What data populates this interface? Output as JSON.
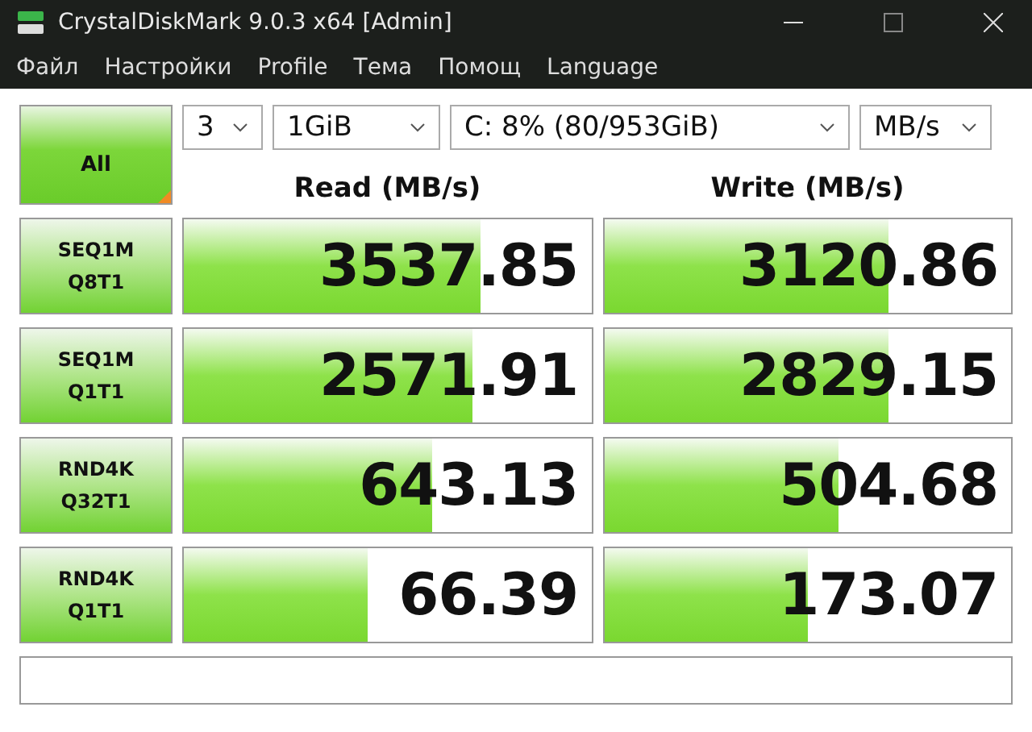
{
  "window": {
    "title": "CrystalDiskMark 9.0.3 x64 [Admin]"
  },
  "menu": [
    "Файл",
    "Настройки",
    "Profile",
    "Тема",
    "Помощ",
    "Language"
  ],
  "all_button": "All",
  "selects": [
    {
      "value": "3"
    },
    {
      "value": "1GiB"
    },
    {
      "value": "C: 8% (80/953GiB)"
    },
    {
      "value": "MB/s"
    }
  ],
  "columns": [
    "Read (MB/s)",
    "Write (MB/s)"
  ],
  "tests": [
    {
      "line1": "SEQ1M",
      "line2": "Q8T1",
      "read": {
        "value": "3537.85",
        "level": 0.73
      },
      "write": {
        "value": "3120.86",
        "level": 0.7
      }
    },
    {
      "line1": "SEQ1M",
      "line2": "Q1T1",
      "read": {
        "value": "2571.91",
        "level": 0.71
      },
      "write": {
        "value": "2829.15",
        "level": 0.7
      }
    },
    {
      "line1": "RND4K",
      "line2": "Q32T1",
      "read": {
        "value": "643.13",
        "level": 0.61
      },
      "write": {
        "value": "504.68",
        "level": 0.575
      }
    },
    {
      "line1": "RND4K",
      "line2": "Q1T1",
      "read": {
        "value": "66.39",
        "level": 0.45
      },
      "write": {
        "value": "173.07",
        "level": 0.5
      }
    }
  ]
}
